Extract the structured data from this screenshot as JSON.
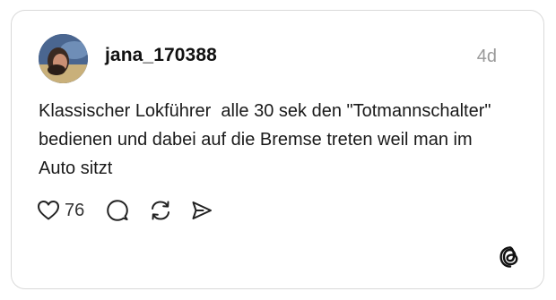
{
  "post": {
    "username": "jana_170388",
    "timestamp": "4d",
    "text": "Klassischer Lokführer  alle 30 sek den \"Totmannschalter\" bedienen und dabei auf die Bremse treten weil man im Auto sitzt",
    "like_count": "76"
  },
  "icons": {
    "like": "heart-icon",
    "reply": "comment-icon",
    "repost": "repost-icon",
    "share": "send-icon",
    "brand": "threads-logo"
  },
  "colors": {
    "text": "#111111",
    "muted": "#999999",
    "border": "#d9d9d9"
  }
}
